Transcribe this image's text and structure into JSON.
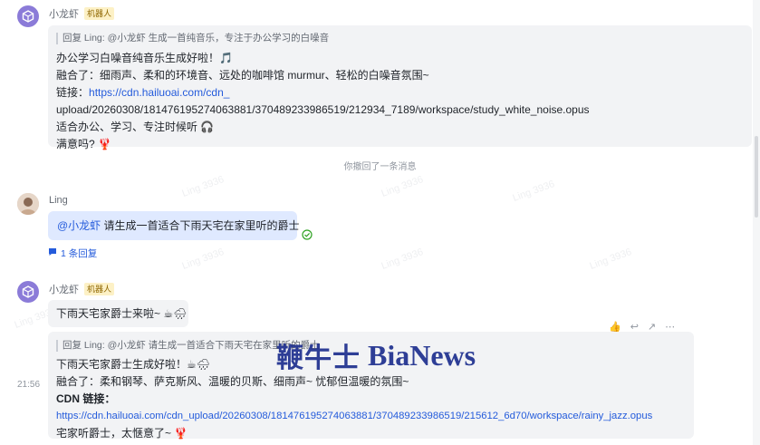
{
  "bot": {
    "name": "小龙虾",
    "badge": "机器人"
  },
  "user": {
    "name": "Ling"
  },
  "msg1": {
    "quote": "回复 Ling: @小龙虾 生成一首纯音乐，专注于办公学习的白噪音",
    "line1": "办公学习白噪音纯音乐生成好啦！🎵",
    "line2": "融合了：细雨声、柔和的环境音、远处的咖啡馆 murmur、轻松的白噪音氛围~",
    "link_label": "链接：",
    "link_part1": "https://cdn.hailuoai.com/cdn_",
    "link_part2": "upload/20260308/181476195274063881/370489233986519/212934_7189/workspace/study_white_noise.opus",
    "line4": "适合办公、学习、专注时候听 🎧",
    "line5": "满意吗? 🦞"
  },
  "system_note": "你撤回了一条消息",
  "msg2": {
    "mention": "@小龙虾",
    "text": " 请生成一首适合下雨天宅在家里听的爵士",
    "reply_count": "1 条回复"
  },
  "msg3": {
    "text": "下雨天宅家爵士来啦~ ☕🌧"
  },
  "msg4": {
    "quote": "回复 Ling: @小龙虾 请生成一首适合下雨天宅在家里听的爵士",
    "line1": "下雨天宅家爵士生成好啦！☕🌧",
    "line2": "融合了：柔和钢琴、萨克斯风、温暖的贝斯、细雨声~ 忧郁但温暖的氛围~",
    "link_label": "CDN 链接：",
    "link": "https://cdn.hailuoai.com/cdn_upload/20260308/181476195274063881/370489233986519/215612_6d70/workspace/rainy_jazz.opus",
    "line4": "宅家听爵士，太惬意了~ 🦞",
    "time": "21:56"
  },
  "watermark_text": "Ling 3936",
  "brand_watermark": {
    "cn": "鞭牛士",
    "en": "BiaNews"
  },
  "icons": [
    "bot-avatar-icon",
    "user-avatar",
    "reply-thread-icon",
    "read-check-icon",
    "thumbs-up-icon",
    "reply-icon",
    "share-icon",
    "more-icon"
  ]
}
